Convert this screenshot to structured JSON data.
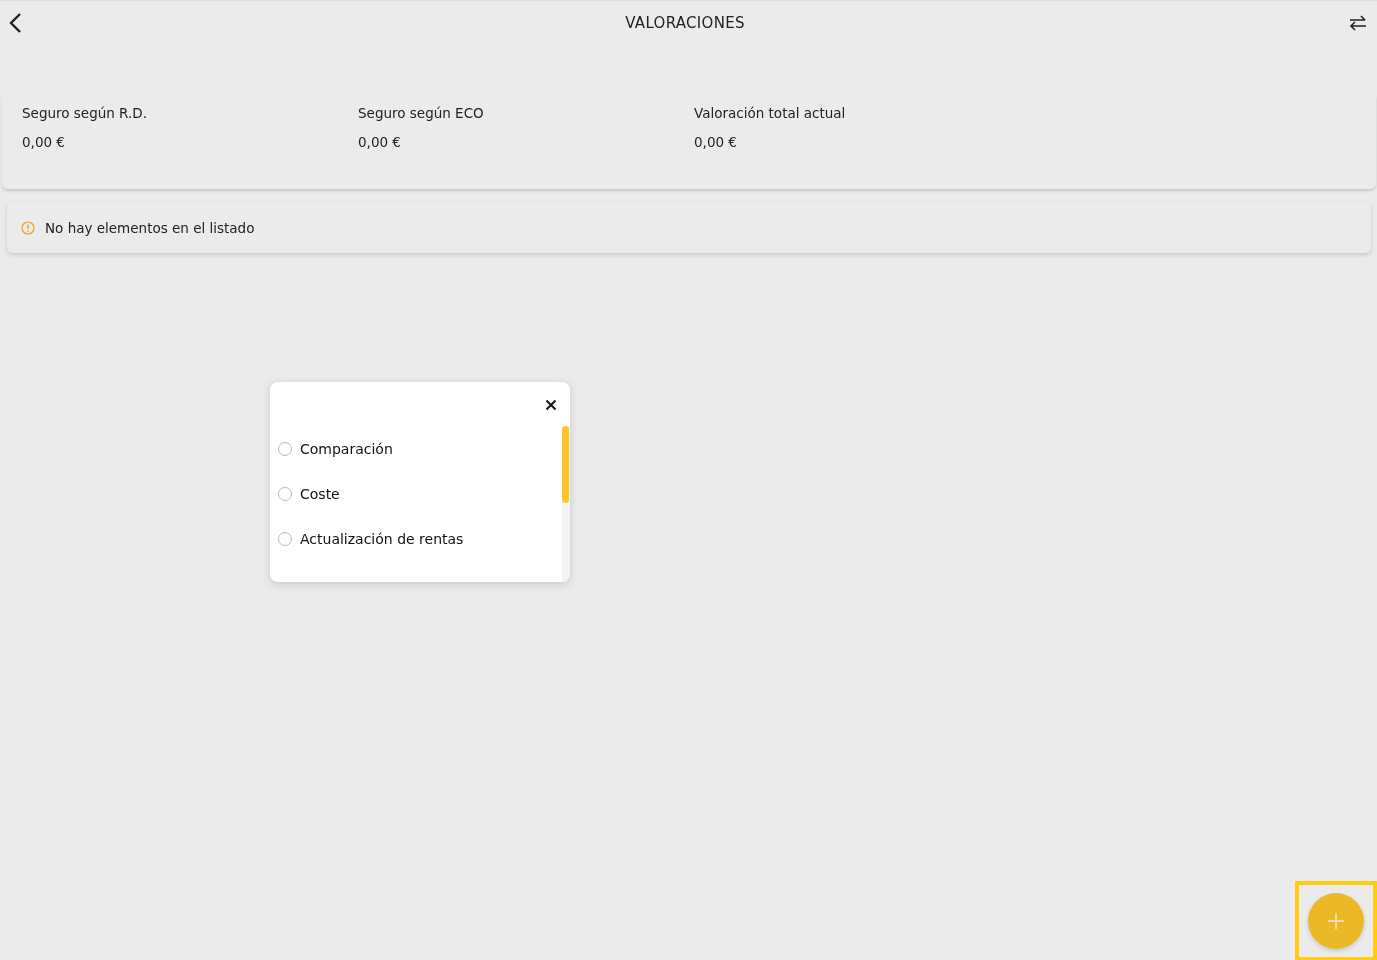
{
  "header": {
    "title": "VALORACIONES"
  },
  "summary": [
    {
      "label": "Seguro según R.D.",
      "value": "0,00 €"
    },
    {
      "label": "Seguro según ECO",
      "value": "0,00 €"
    },
    {
      "label": "Valoración total actual",
      "value": "0,00 €"
    }
  ],
  "notice": {
    "text": "No hay elementos en el listado"
  },
  "dialog": {
    "options": [
      {
        "label": "Comparación",
        "selected": false
      },
      {
        "label": "Coste",
        "selected": false
      },
      {
        "label": "Actualización de rentas",
        "selected": false
      }
    ]
  },
  "fab": {
    "focused": true
  }
}
